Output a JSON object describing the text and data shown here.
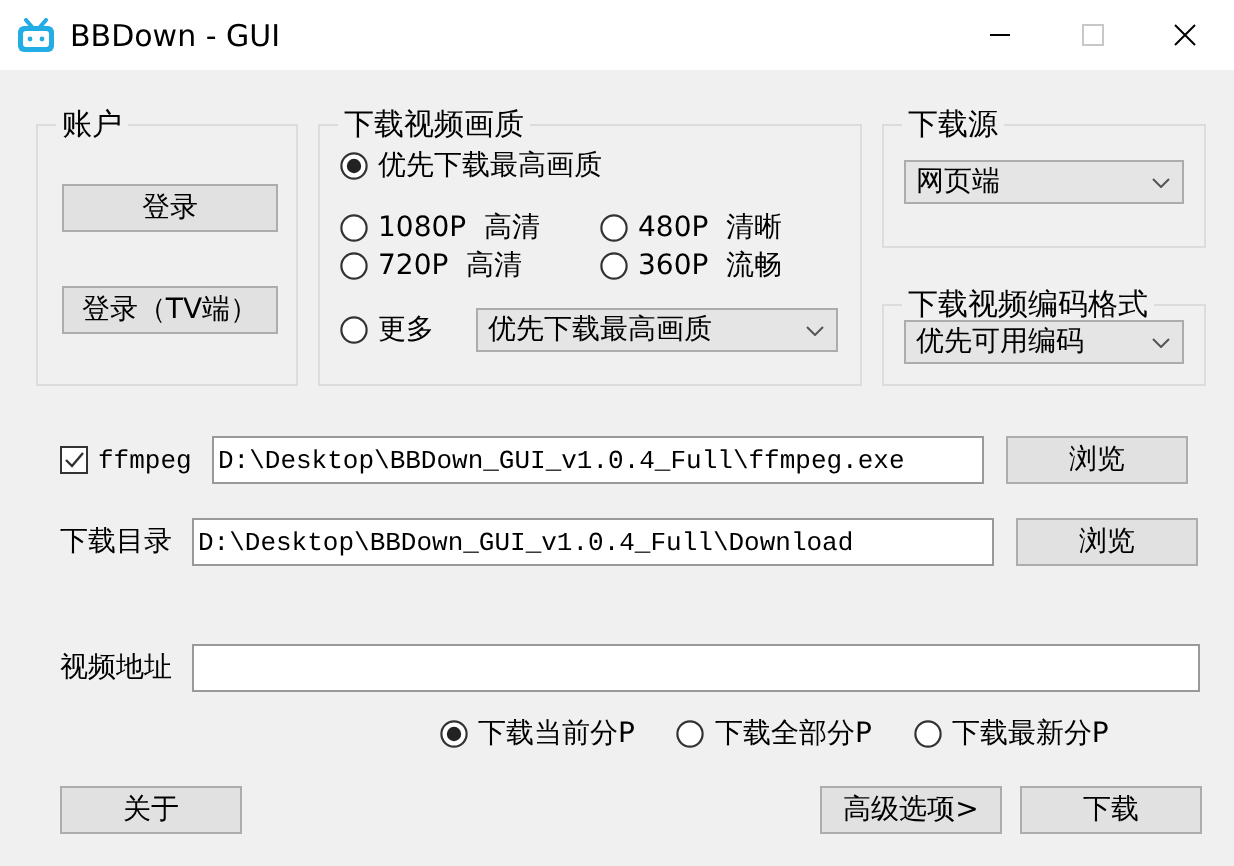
{
  "window": {
    "title": "BBDown - GUI"
  },
  "account": {
    "title": "账户",
    "buttons": [
      "登录",
      "登录（TV端）"
    ]
  },
  "quality": {
    "title": "下载视频画质",
    "options": [
      {
        "label": "优先下载最高画质",
        "selected": true
      },
      {
        "label": "1080P  高清",
        "selected": false
      },
      {
        "label": "480P  清晰",
        "selected": false
      },
      {
        "label": "720P  高清",
        "selected": false
      },
      {
        "label": "360P  流畅",
        "selected": false
      },
      {
        "label": "更多",
        "selected": false
      }
    ],
    "more_value": "优先下载最高画质"
  },
  "source": {
    "title": "下载源",
    "value": "网页端"
  },
  "codec": {
    "title": "下载视频编码格式",
    "value": "优先可用编码"
  },
  "ffmpeg": {
    "label": "ffmpeg",
    "checked": true,
    "value": "D:\\Desktop\\BBDown_GUI_v1.0.4_Full\\ffmpeg.exe",
    "browse": "浏览"
  },
  "download_dir": {
    "label": "下载目录",
    "value": "D:\\Desktop\\BBDown_GUI_v1.0.4_Full\\Download",
    "browse": "浏览"
  },
  "video_url": {
    "label": "视频地址"
  },
  "part_options": [
    {
      "label": "下载当前分P",
      "selected": true
    },
    {
      "label": "下载全部分P",
      "selected": false
    },
    {
      "label": "下载最新分P",
      "selected": false
    }
  ],
  "buttons": {
    "about": "关于",
    "advanced": "高级选项>",
    "download": "下载"
  }
}
